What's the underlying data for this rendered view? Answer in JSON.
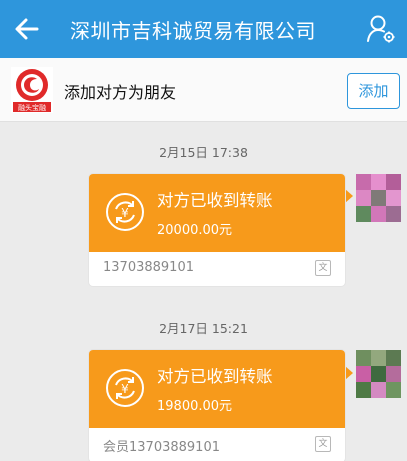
{
  "header": {
    "back_icon": "arrow-left-icon",
    "title": "深圳市吉科诚贸易有限公司",
    "profile_icon": "person-settings-icon",
    "background": "#2e96dc"
  },
  "banner": {
    "logo_caption": "融头宝融",
    "text": "添加对方为朋友",
    "add_label": "添加"
  },
  "messages": [
    {
      "timestamp": "2月15日 17:38",
      "title": "对方已收到转账",
      "amount": "20000.00元",
      "footer": "13703889101",
      "tag": "文"
    },
    {
      "timestamp": "2月17日 15:21",
      "title": "对方已收到转账",
      "amount": "19800.00元",
      "footer": "会员13703889101",
      "tag": "文"
    }
  ],
  "colors": {
    "accent": "#2e96dc",
    "transfer_orange": "#f79a1b",
    "chat_background": "#ebebeb"
  }
}
